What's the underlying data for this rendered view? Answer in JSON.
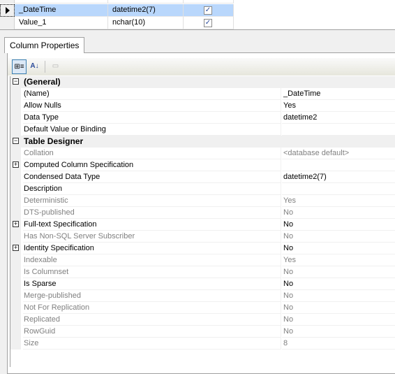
{
  "columns_grid": {
    "rows": [
      {
        "name": "_DateTime",
        "type": "datetime2(7)",
        "allow_nulls": true,
        "selected": true
      },
      {
        "name": "Value_1",
        "type": "nchar(10)",
        "allow_nulls": true,
        "selected": false
      }
    ]
  },
  "tab": {
    "label": "Column Properties"
  },
  "toolbar": {
    "categorized": "categorized-icon",
    "alphabetical": "sort-alphabetical-icon",
    "property_pages": "property-pages-icon"
  },
  "properties": [
    {
      "cat": true,
      "name": "(General)",
      "expanded": true
    },
    {
      "name": "(Name)",
      "value": "_DateTime"
    },
    {
      "name": "Allow Nulls",
      "value": "Yes"
    },
    {
      "name": "Data Type",
      "value": "datetime2"
    },
    {
      "name": "Default Value or Binding",
      "value": ""
    },
    {
      "cat": true,
      "name": "Table Designer",
      "expanded": true
    },
    {
      "name": "Collation",
      "value": "<database default>",
      "ro": true
    },
    {
      "name": "Computed Column Specification",
      "value": "",
      "expandable": true
    },
    {
      "name": "Condensed Data Type",
      "value": "datetime2(7)"
    },
    {
      "name": "Description",
      "value": ""
    },
    {
      "name": "Deterministic",
      "value": "Yes",
      "ro": true
    },
    {
      "name": "DTS-published",
      "value": "No",
      "ro": true
    },
    {
      "name": "Full-text Specification",
      "value": "No",
      "expandable": true
    },
    {
      "name": "Has Non-SQL Server Subscriber",
      "value": "No",
      "ro": true
    },
    {
      "name": "Identity Specification",
      "value": "No",
      "expandable": true
    },
    {
      "name": "Indexable",
      "value": "Yes",
      "ro": true
    },
    {
      "name": "Is Columnset",
      "value": "No",
      "ro": true
    },
    {
      "name": "Is Sparse",
      "value": "No"
    },
    {
      "name": "Merge-published",
      "value": "No",
      "ro": true
    },
    {
      "name": "Not For Replication",
      "value": "No",
      "ro": true
    },
    {
      "name": "Replicated",
      "value": "No",
      "ro": true
    },
    {
      "name": "RowGuid",
      "value": "No",
      "ro": true
    },
    {
      "name": "Size",
      "value": "8",
      "ro": true
    }
  ]
}
